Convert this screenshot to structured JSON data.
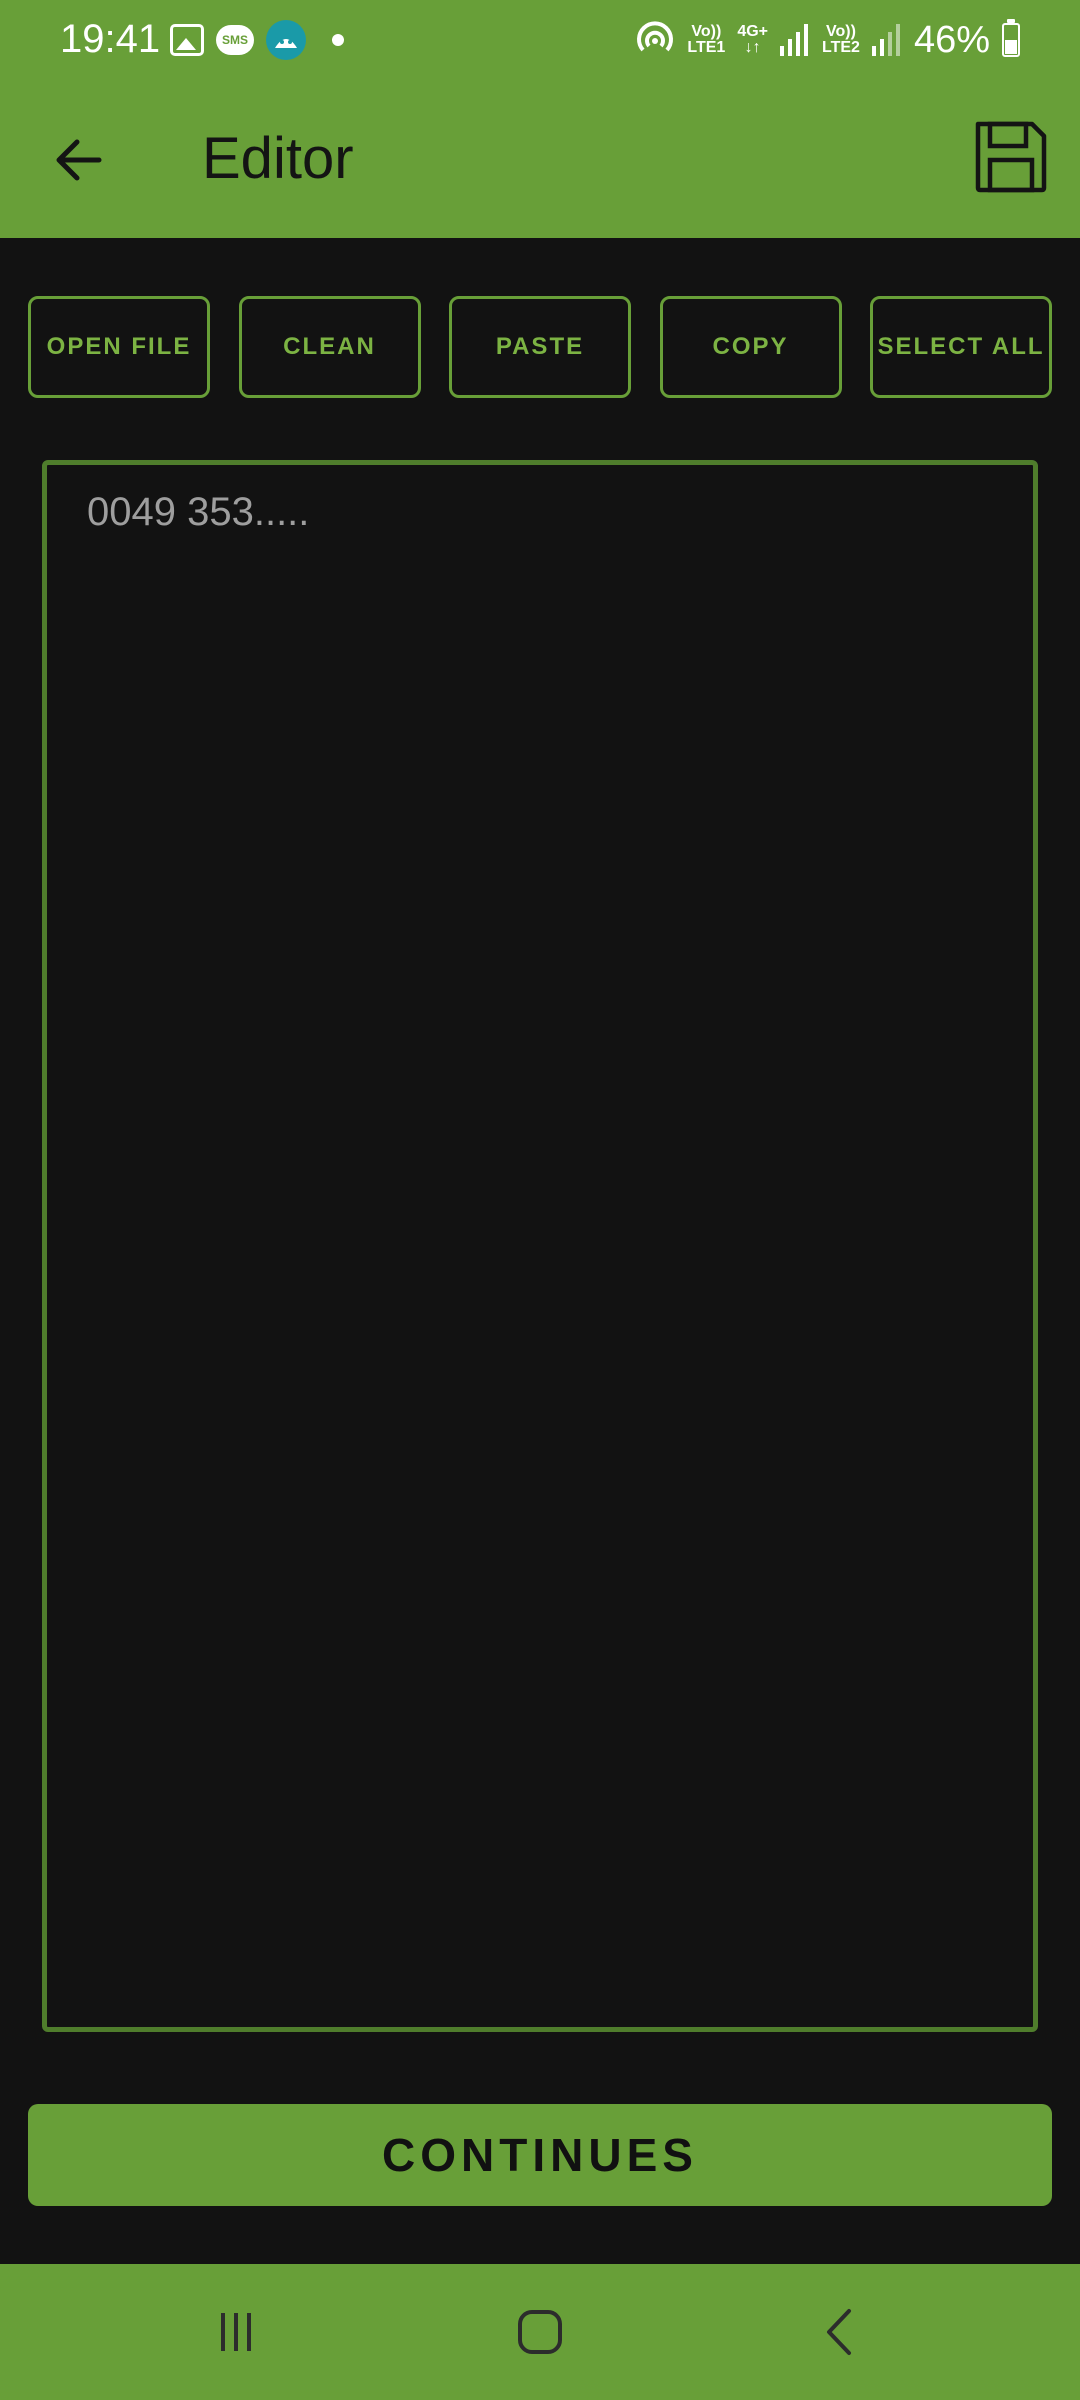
{
  "status_bar": {
    "time": "19:41",
    "notification_icons": [
      "image-icon",
      "sms-icon",
      "android-icon",
      "dot-icon"
    ],
    "sms_label": "SMS",
    "hotspot_icon": "hotspot-icon",
    "sim1": {
      "top": "Vo))",
      "bottom": "LTE1"
    },
    "network": {
      "top": "4G+",
      "bottom": "↓↑"
    },
    "sim2": {
      "top": "Vo))",
      "bottom": "LTE2"
    },
    "battery_percent": "46%",
    "battery_level": 0.46
  },
  "app_bar": {
    "title": "Editor",
    "back_icon": "arrow-left-icon",
    "save_icon": "floppy-disk-icon"
  },
  "toolbar": {
    "buttons": [
      {
        "label": "OPEN FILE"
      },
      {
        "label": "CLEAN"
      },
      {
        "label": "PASTE"
      },
      {
        "label": "COPY"
      },
      {
        "label": "SELECT ALL"
      }
    ]
  },
  "editor": {
    "placeholder": "0049 353....."
  },
  "footer": {
    "continue_label": "CONTINUES"
  },
  "nav_bar": {
    "items": [
      "recent-apps-icon",
      "home-icon",
      "back-icon"
    ]
  },
  "colors": {
    "accent": "#689f38",
    "background": "#121212",
    "button_text": "#7cb343",
    "placeholder_text": "#9e9e9e"
  }
}
